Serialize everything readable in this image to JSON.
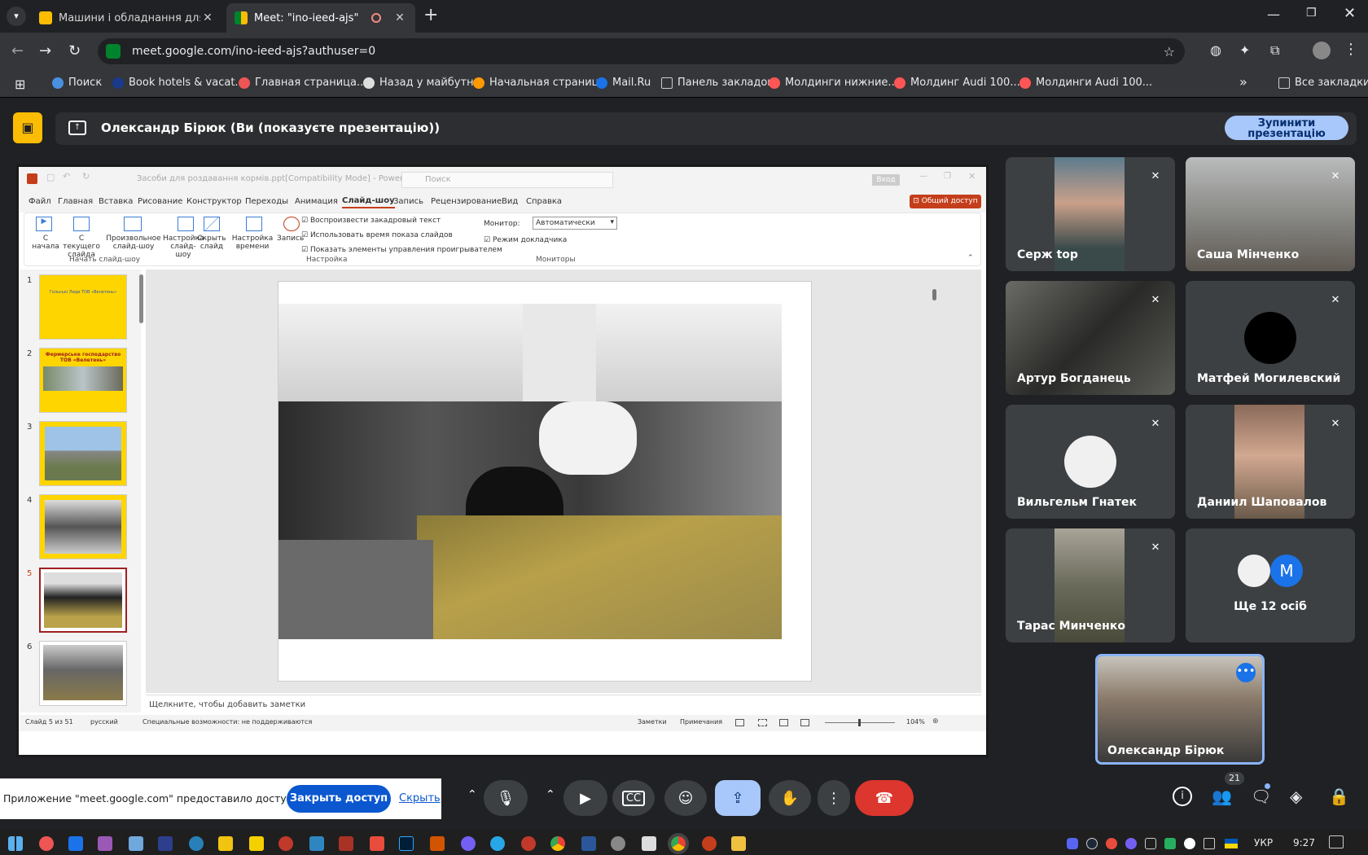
{
  "browser": {
    "tabs": [
      {
        "title": "Машини і обладнання для тва",
        "close": "✕"
      },
      {
        "title": "Meet: \"ino-ieed-ajs\"",
        "close": "✕"
      }
    ],
    "new_tab": "+",
    "url": "meet.google.com/ino-ieed-ajs?authuser=0",
    "bookmarks": [
      {
        "label": "Поиск",
        "color": "#4a90e2"
      },
      {
        "label": "Book hotels & vacat...",
        "color": "#1a3a8a"
      },
      {
        "label": "Главная страница...",
        "color": "#e55"
      },
      {
        "label": "Назад у майбутнє",
        "color": "#ddd"
      },
      {
        "label": "Начальная страница",
        "color": "#f90"
      },
      {
        "label": "Mail.Ru",
        "color": "#1a73e8"
      },
      {
        "label": "Панель закладок",
        "color": "#888"
      },
      {
        "label": "Молдинги нижние...",
        "color": "#f55"
      },
      {
        "label": "Молдинг Audi 100...",
        "color": "#f55"
      },
      {
        "label": "Молдинги Audi 100...",
        "color": "#f55"
      }
    ],
    "all_bookmarks": "Все закладки",
    "more": "»"
  },
  "meet": {
    "banner_text": "Олександр Бірюк (Ви (показуєте презентацію))",
    "stop_button": "Зупинити презентацію",
    "participants": [
      {
        "name": "Серж top",
        "muted": true,
        "bg": "#6b7d8a"
      },
      {
        "name": "Саша Мінченко",
        "muted": true,
        "bg": "#8a8f92"
      },
      {
        "name": "Артур Богданець",
        "muted": true,
        "bg": "#4a4a48"
      },
      {
        "name": "Матфей Могилевский",
        "muted": true,
        "bg": "#3c4043"
      },
      {
        "name": "Вильгельм Гнатек",
        "muted": true,
        "bg": "#3c4043"
      },
      {
        "name": "Даниил Шаповалов",
        "muted": true,
        "bg": "#7a6a5a"
      },
      {
        "name": "Тарас Минченко",
        "muted": true,
        "bg": "#6b6a5a"
      },
      {
        "name": "Ще 12 осіб",
        "muted": false,
        "bg": "#3c4043"
      }
    ],
    "more_avatar_letter": "M",
    "self_name": "Олександр Бірюк",
    "participant_count": "21",
    "share_notice": "Приложение \"meet.google.com\" предоставило доступ к окну.",
    "close_access": "Закрыть доступ",
    "hide": "Скрыть"
  },
  "powerpoint": {
    "title": "Засоби для роздавання кормів.ppt[Compatibility Mode] - PowerPoint",
    "search": "Поиск",
    "signin": "Вход",
    "share": "Общий доступ",
    "menu": [
      "Файл",
      "Главная",
      "Вставка",
      "Рисование",
      "Конструктор",
      "Переходы",
      "Анимация",
      "Слайд-шоу",
      "Запись",
      "Рецензирование",
      "Вид",
      "Справка"
    ],
    "active_menu": "Слайд-шоу",
    "ribbon": {
      "from_start": "С начала",
      "from_current": "С текущего слайда",
      "custom": "Произвольное слайд-шоу",
      "setup": "Настройка слайд-шоу",
      "hide": "Скрыть слайд",
      "timings": "Настройка времени",
      "record": "Запись",
      "cb1": "Воспроизвести закадровый текст",
      "cb2": "Использовать время показа слайдов",
      "cb3": "Показать элементы управления проигрывателем",
      "monitor_label": "Монитор:",
      "monitor_value": "Автоматически",
      "presenter": "Режим докладчика",
      "group1": "Начать слайд-шоу",
      "group2": "Настройка",
      "group3": "Мониторы"
    },
    "slides": [
      "1",
      "2",
      "3",
      "4",
      "5",
      "6"
    ],
    "slide1_title": "Гольські Лиди ТОВ «Велетень»",
    "slide2_title": "Фермерське господарство ТОВ «Велетень»",
    "notes": "Щелкните, чтобы добавить заметки",
    "status_slide": "Слайд 5 из 51",
    "status_lang": "русский",
    "status_access": "Специальные возможности: не поддерживаются",
    "status_notes": "Заметки",
    "status_comments": "Примечания",
    "zoom": "104%"
  },
  "taskbar": {
    "lang": "УКР",
    "time": "9:27"
  }
}
